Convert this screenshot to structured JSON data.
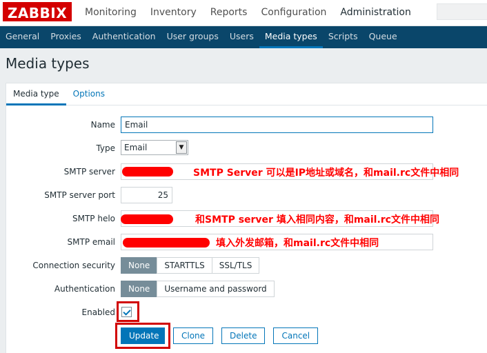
{
  "header": {
    "logo": "ZABBIX",
    "nav": [
      "Monitoring",
      "Inventory",
      "Reports",
      "Configuration",
      "Administration"
    ],
    "active_nav": "Administration"
  },
  "subnav": {
    "items": [
      "General",
      "Proxies",
      "Authentication",
      "User groups",
      "Users",
      "Media types",
      "Scripts",
      "Queue"
    ],
    "active": "Media types"
  },
  "page": {
    "title": "Media types"
  },
  "tabs": [
    "Media type",
    "Options"
  ],
  "form": {
    "name": {
      "label": "Name",
      "value": "Email"
    },
    "type": {
      "label": "Type",
      "value": "Email"
    },
    "smtp_server": {
      "label": "SMTP server",
      "value": ""
    },
    "smtp_port": {
      "label": "SMTP server port",
      "value": "25"
    },
    "smtp_helo": {
      "label": "SMTP helo",
      "value": ""
    },
    "smtp_email": {
      "label": "SMTP email",
      "value": ""
    },
    "connection_security": {
      "label": "Connection security",
      "options": [
        "None",
        "STARTTLS",
        "SSL/TLS"
      ],
      "selected": "None"
    },
    "authentication": {
      "label": "Authentication",
      "options": [
        "None",
        "Username and password"
      ],
      "selected": "None"
    },
    "enabled": {
      "label": "Enabled",
      "checked": true
    },
    "buttons": {
      "update": "Update",
      "clone": "Clone",
      "delete": "Delete",
      "cancel": "Cancel"
    }
  },
  "annotations": {
    "smtp_server": "SMTP Server 可以是IP地址或域名，和mail.rc文件中相同",
    "smtp_helo": "和SMTP server 填入相同内容，和mail.rc文件中相同",
    "smtp_email": "填入外发邮箱，和mail.rc文件中相同"
  },
  "colors": {
    "logo_red": "#d40000",
    "subnav_bg": "#0a466a",
    "accent_blue": "#0275b8",
    "annotation_red": "#ff0000",
    "segment_on": "#768d99"
  }
}
